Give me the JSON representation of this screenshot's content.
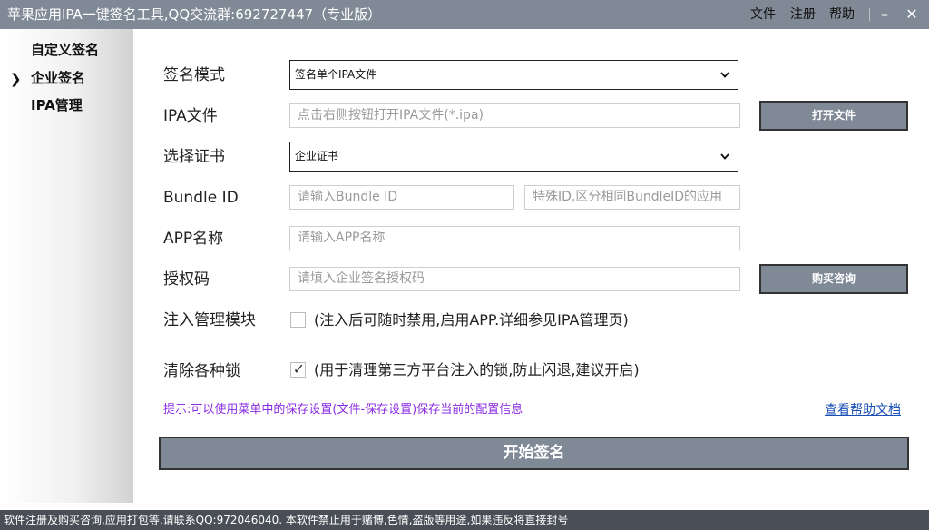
{
  "window": {
    "title": "苹果应用IPA一键签名工具,QQ交流群:692727447（专业版）",
    "menu": [
      "文件",
      "注册",
      "帮助"
    ],
    "minimize_glyph": "–",
    "close_glyph": "✕"
  },
  "sidebar": {
    "active_marker": "❯",
    "items": [
      {
        "label": "自定义签名"
      },
      {
        "label": "企业签名"
      },
      {
        "label": "IPA管理"
      }
    ]
  },
  "form": {
    "sign_mode": {
      "label": "签名模式",
      "value": "签名单个IPA文件"
    },
    "ipa_file": {
      "label": "IPA文件",
      "placeholder": "点击右侧按钮打开IPA文件(*.ipa)",
      "button": "打开文件"
    },
    "certificate": {
      "label": "选择证书",
      "value": "企业证书"
    },
    "bundle_id": {
      "label": "Bundle ID",
      "placeholder": "请输入Bundle ID",
      "special_placeholder": "特殊ID,区分相同BundleID的应用"
    },
    "app_name": {
      "label": "APP名称",
      "placeholder": "请输入APP名称"
    },
    "auth_code": {
      "label": "授权码",
      "placeholder": "请填入企业签名授权码",
      "button": "购买咨询"
    },
    "inject_module": {
      "label": "注入管理模块",
      "checked": false,
      "description": "(注入后可随时禁用,启用APP.详细参见IPA管理页)"
    },
    "clear_locks": {
      "label": "清除各种锁",
      "checked": true,
      "check_glyph": "✓",
      "description": "(用于清理第三方平台注入的锁,防止闪退,建议开启)"
    }
  },
  "hint": "提示:可以使用菜单中的保存设置(文件-保存设置)保存当前的配置信息",
  "help_link": "查看帮助文档",
  "start_button": "开始签名",
  "status_bar": "软件注册及购买咨询,应用打包等,请联系QQ:972046040.  本软件禁止用于赌博,色情,盗版等用途,如果违反将直接封号",
  "colors": {
    "titlebar": "#7f8a96",
    "button": "#7f8a96",
    "hint": "#8a2be2",
    "link": "#1a4fb5",
    "statusbar": "#4a4f57"
  }
}
